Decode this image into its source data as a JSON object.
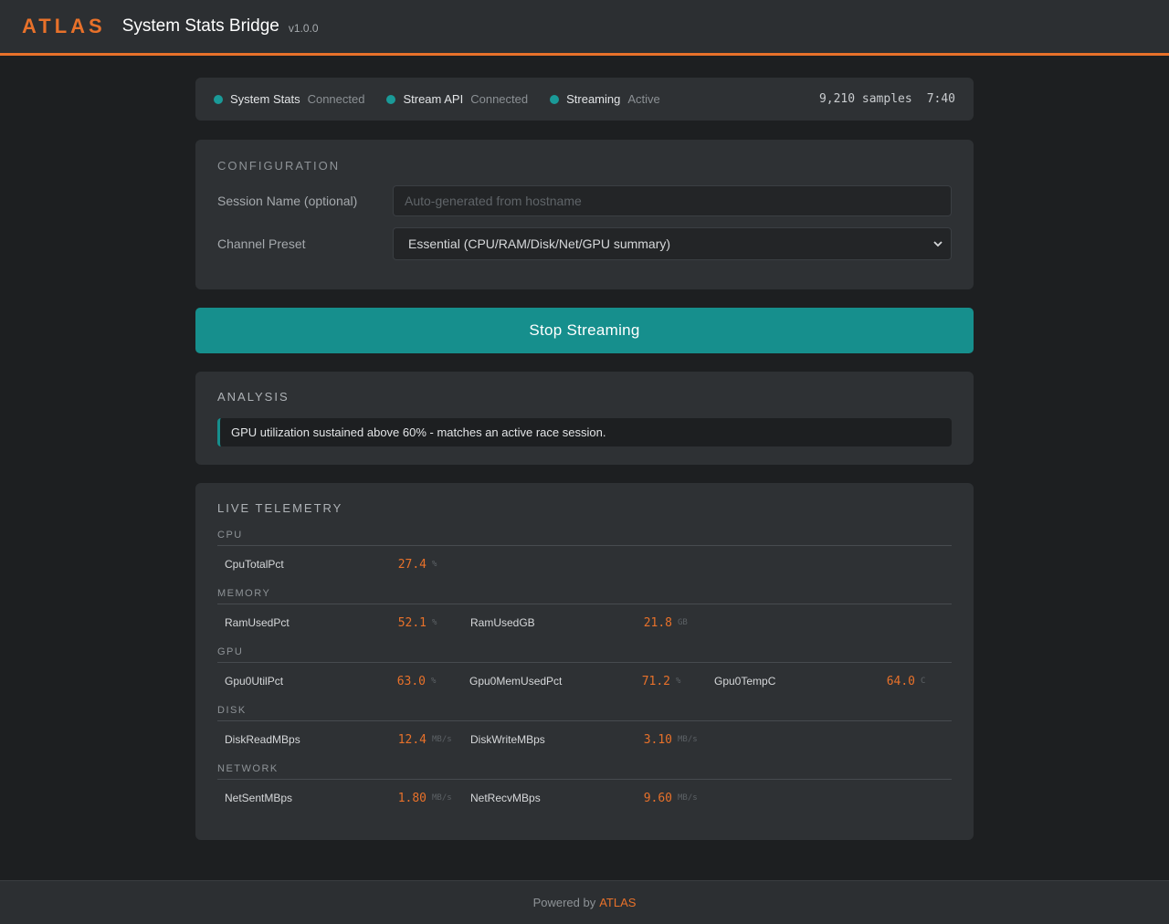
{
  "header": {
    "logo": "ATLAS",
    "title": "System Stats Bridge",
    "version": "v1.0.0"
  },
  "status": {
    "items": [
      {
        "name": "System Stats",
        "state": "Connected"
      },
      {
        "name": "Stream API",
        "state": "Connected"
      },
      {
        "name": "Streaming",
        "state": "Active"
      }
    ],
    "samples": "9,210 samples",
    "elapsed": "7:40"
  },
  "config": {
    "title": "CONFIGURATION",
    "session_label": "Session Name (optional)",
    "session_placeholder": "Auto-generated from hostname",
    "session_value": "",
    "preset_label": "Channel Preset",
    "preset_value": "Essential (CPU/RAM/Disk/Net/GPU summary)"
  },
  "action": {
    "stop_label": "Stop Streaming"
  },
  "analysis": {
    "title": "ANALYSIS",
    "message": "GPU utilization sustained above 60% - matches an active race session."
  },
  "telemetry": {
    "title": "LIVE TELEMETRY",
    "groups": [
      {
        "label": "CPU",
        "metrics": [
          {
            "name": "CpuTotalPct",
            "value": "27.4",
            "unit": "%"
          }
        ]
      },
      {
        "label": "MEMORY",
        "metrics": [
          {
            "name": "RamUsedPct",
            "value": "52.1",
            "unit": "%"
          },
          {
            "name": "RamUsedGB",
            "value": "21.8",
            "unit": "GB"
          }
        ]
      },
      {
        "label": "GPU",
        "metrics": [
          {
            "name": "Gpu0UtilPct",
            "value": "63.0",
            "unit": "%"
          },
          {
            "name": "Gpu0MemUsedPct",
            "value": "71.2",
            "unit": "%"
          },
          {
            "name": "Gpu0TempC",
            "value": "64.0",
            "unit": "C"
          }
        ]
      },
      {
        "label": "DISK",
        "metrics": [
          {
            "name": "DiskReadMBps",
            "value": "12.4",
            "unit": "MB/s"
          },
          {
            "name": "DiskWriteMBps",
            "value": "3.10",
            "unit": "MB/s"
          }
        ]
      },
      {
        "label": "NETWORK",
        "metrics": [
          {
            "name": "NetSentMBps",
            "value": "1.80",
            "unit": "MB/s"
          },
          {
            "name": "NetRecvMBps",
            "value": "9.60",
            "unit": "MB/s"
          }
        ]
      }
    ]
  },
  "footer": {
    "prefix": "Powered by",
    "brand": "ATLAS"
  },
  "colors": {
    "accent": "#e8712a",
    "teal": "#168f8d",
    "background": "#1d1f21",
    "card": "#2e3134"
  }
}
